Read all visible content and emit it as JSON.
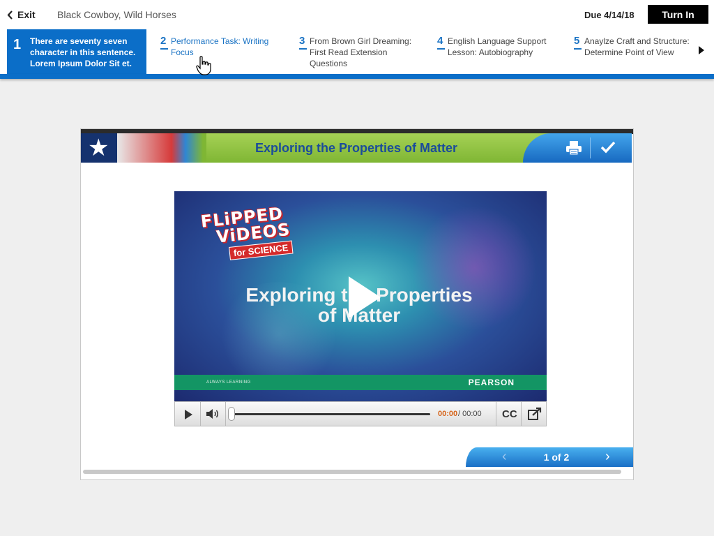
{
  "header": {
    "exit_label": "Exit",
    "lesson_title": "Black Cowboy, Wild Horses",
    "due": "Due 4/14/18",
    "turn_in_label": "Turn In"
  },
  "tasks": [
    {
      "number": "1",
      "label": "There are seventy seven character in this sentence. Lorem Ipsum Dolor Sit et.",
      "active": true
    },
    {
      "number": "2",
      "label": "Performance Task: Writing Focus"
    },
    {
      "number": "3",
      "label": "From Brown Girl Dreaming: First Read Extension Questions"
    },
    {
      "number": "4",
      "label": "English Language Support Lesson: Autobiography"
    },
    {
      "number": "5",
      "label": "Anaylze Craft and Structure: Determine Point of View"
    }
  ],
  "content": {
    "banner_title": "Exploring the Properties of Matter",
    "video": {
      "brand_line1": "FLiPPED",
      "brand_line2": "ViDEOS",
      "brand_line3": "for SCIENCE",
      "title": "Exploring the Properties of Matter",
      "footer_left": "ALWAYS LEARNING",
      "footer_right": "PEARSON"
    },
    "player": {
      "current_time": "00:00",
      "duration": "/ 00:00",
      "cc_label": "CC",
      "progress": 0
    },
    "pager": {
      "label": "1 of 2"
    }
  },
  "colors": {
    "accent_blue": "#0b6ec8",
    "banner_green": "#8cc63f",
    "time_orange": "#d6641a",
    "pearson_green": "#139564"
  }
}
